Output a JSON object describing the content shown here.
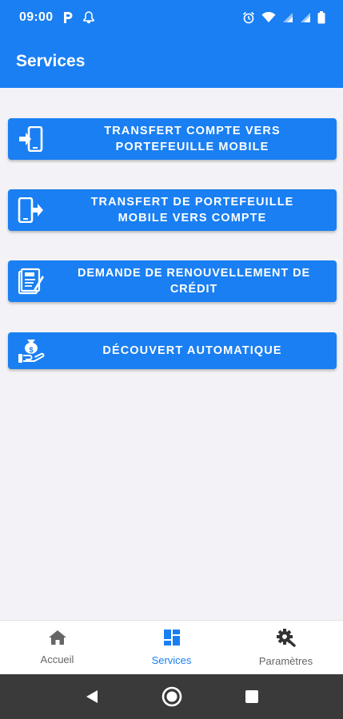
{
  "status_bar": {
    "time": "09:00",
    "left_icons": [
      "parking-p-icon",
      "notification-bell-icon"
    ],
    "right_icons": [
      "alarm-clock-icon",
      "wifi-icon",
      "signal-icon",
      "signal-icon",
      "battery-icon"
    ]
  },
  "app_bar": {
    "title": "Services"
  },
  "services": [
    {
      "icon": "phone-transfer-in-icon",
      "label_line1": "TRANSFERT COMPTE VERS",
      "label_line2": "PORTEFEUILLE MOBILE"
    },
    {
      "icon": "phone-transfer-out-icon",
      "label_line1": "TRANSFERT DE PORTEFEUILLE",
      "label_line2": "MOBILE VERS COMPTE"
    },
    {
      "icon": "loan-document-icon",
      "label_line1": "DEMANDE DE RENOUVELLEMENT DE",
      "label_line2": "CRÉDIT"
    },
    {
      "icon": "money-bag-hand-icon",
      "label_line1": "DÉCOUVERT AUTOMATIQUE",
      "label_line2": ""
    }
  ],
  "bottom_nav": {
    "items": [
      {
        "label": "Accueil",
        "icon": "home-icon",
        "active": false
      },
      {
        "label": "Services",
        "icon": "dashboard-icon",
        "active": true
      },
      {
        "label": "Paramètres",
        "icon": "settings-gear-icon",
        "active": false
      }
    ]
  },
  "system_nav": {
    "icons": [
      "back-triangle-icon",
      "home-circle-icon",
      "recents-square-icon"
    ]
  },
  "colors": {
    "primary": "#1a7ff2",
    "background": "#f3f3f7",
    "nav_inactive": "#666666",
    "system_bar": "#3a3a3a"
  }
}
